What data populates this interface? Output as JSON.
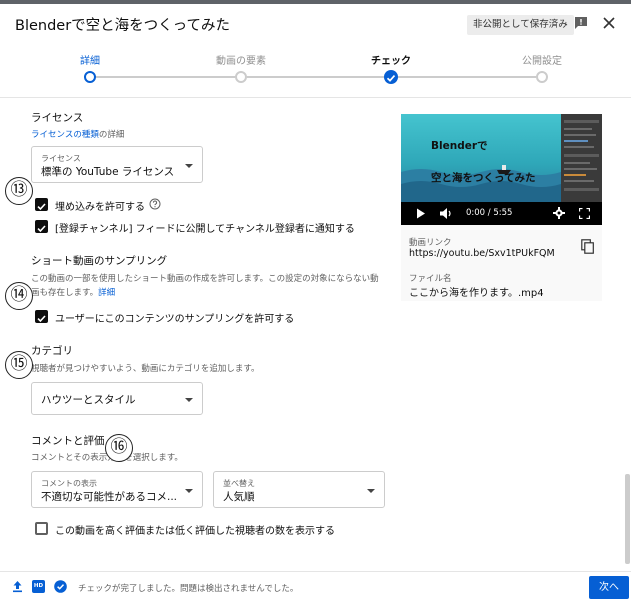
{
  "header": {
    "title": "Blenderで空と海をつくってみた",
    "draft_badge": "非公開として保存済み",
    "feedback_icon": "feedback-icon",
    "close_icon": "close-icon"
  },
  "stepper": {
    "steps": [
      {
        "label": "詳細",
        "state": "current"
      },
      {
        "label": "動画の要素",
        "state": "pending"
      },
      {
        "label": "チェック",
        "state": "done"
      },
      {
        "label": "公開設定",
        "state": "pending"
      }
    ]
  },
  "license": {
    "title": "ライセンス",
    "types_link": "ライセンスの種類",
    "types_suffix": "の詳細",
    "select_label": "ライセンス",
    "select_value": "標準の YouTube ライセンス",
    "allow_embed_label": "埋め込みを許可する",
    "allow_embed_checked": true,
    "notify_label": "[登録チャンネル] フィードに公開してチャンネル登録者に通知する",
    "notify_checked": true
  },
  "shorts": {
    "title": "ショート動画のサンプリング",
    "desc_line1": "この動画の一部を使用したショート動画の作成を許可します。この設定の対象にならない動",
    "desc_line2": "画も存在します。",
    "details_link": "詳細",
    "allow_label": "ユーザーにこのコンテンツのサンプリングを許可する",
    "allow_checked": true
  },
  "category": {
    "title": "カテゴリ",
    "desc": "視聴者が見つけやすいよう、動画にカテゴリを追加します。",
    "value": "ハウツーとスタイル"
  },
  "comments": {
    "title": "コメントと評価",
    "desc": "コメントとその表示方法を選択します。",
    "display_label": "コメントの表示",
    "display_value": "不適切な可能性があるコメ...",
    "sort_label": "並べ替え",
    "sort_value": "人気順",
    "show_ratings_label": "この動画を高く評価または低く評価した視聴者の数を表示する",
    "show_ratings_checked": false
  },
  "annotations": [
    "⑬",
    "⑭",
    "⑮",
    "⑯"
  ],
  "video": {
    "thumb_line1": "Blenderで",
    "thumb_line2": "空と海をつくってみた",
    "time": "0:00 / 5:55",
    "link_label": "動画リンク",
    "link_url": "https://youtu.be/Sxv1tPUkFQM",
    "file_label": "ファイル名",
    "file_name": "ここから海を作ります。.mp4"
  },
  "footer": {
    "status": "チェックが完了しました。問題は検出されませんでした。",
    "hd_badge": "HD",
    "next": "次へ"
  },
  "colors": {
    "accent": "#065fd4",
    "text": "#0d0d0d",
    "muted": "#606060"
  }
}
